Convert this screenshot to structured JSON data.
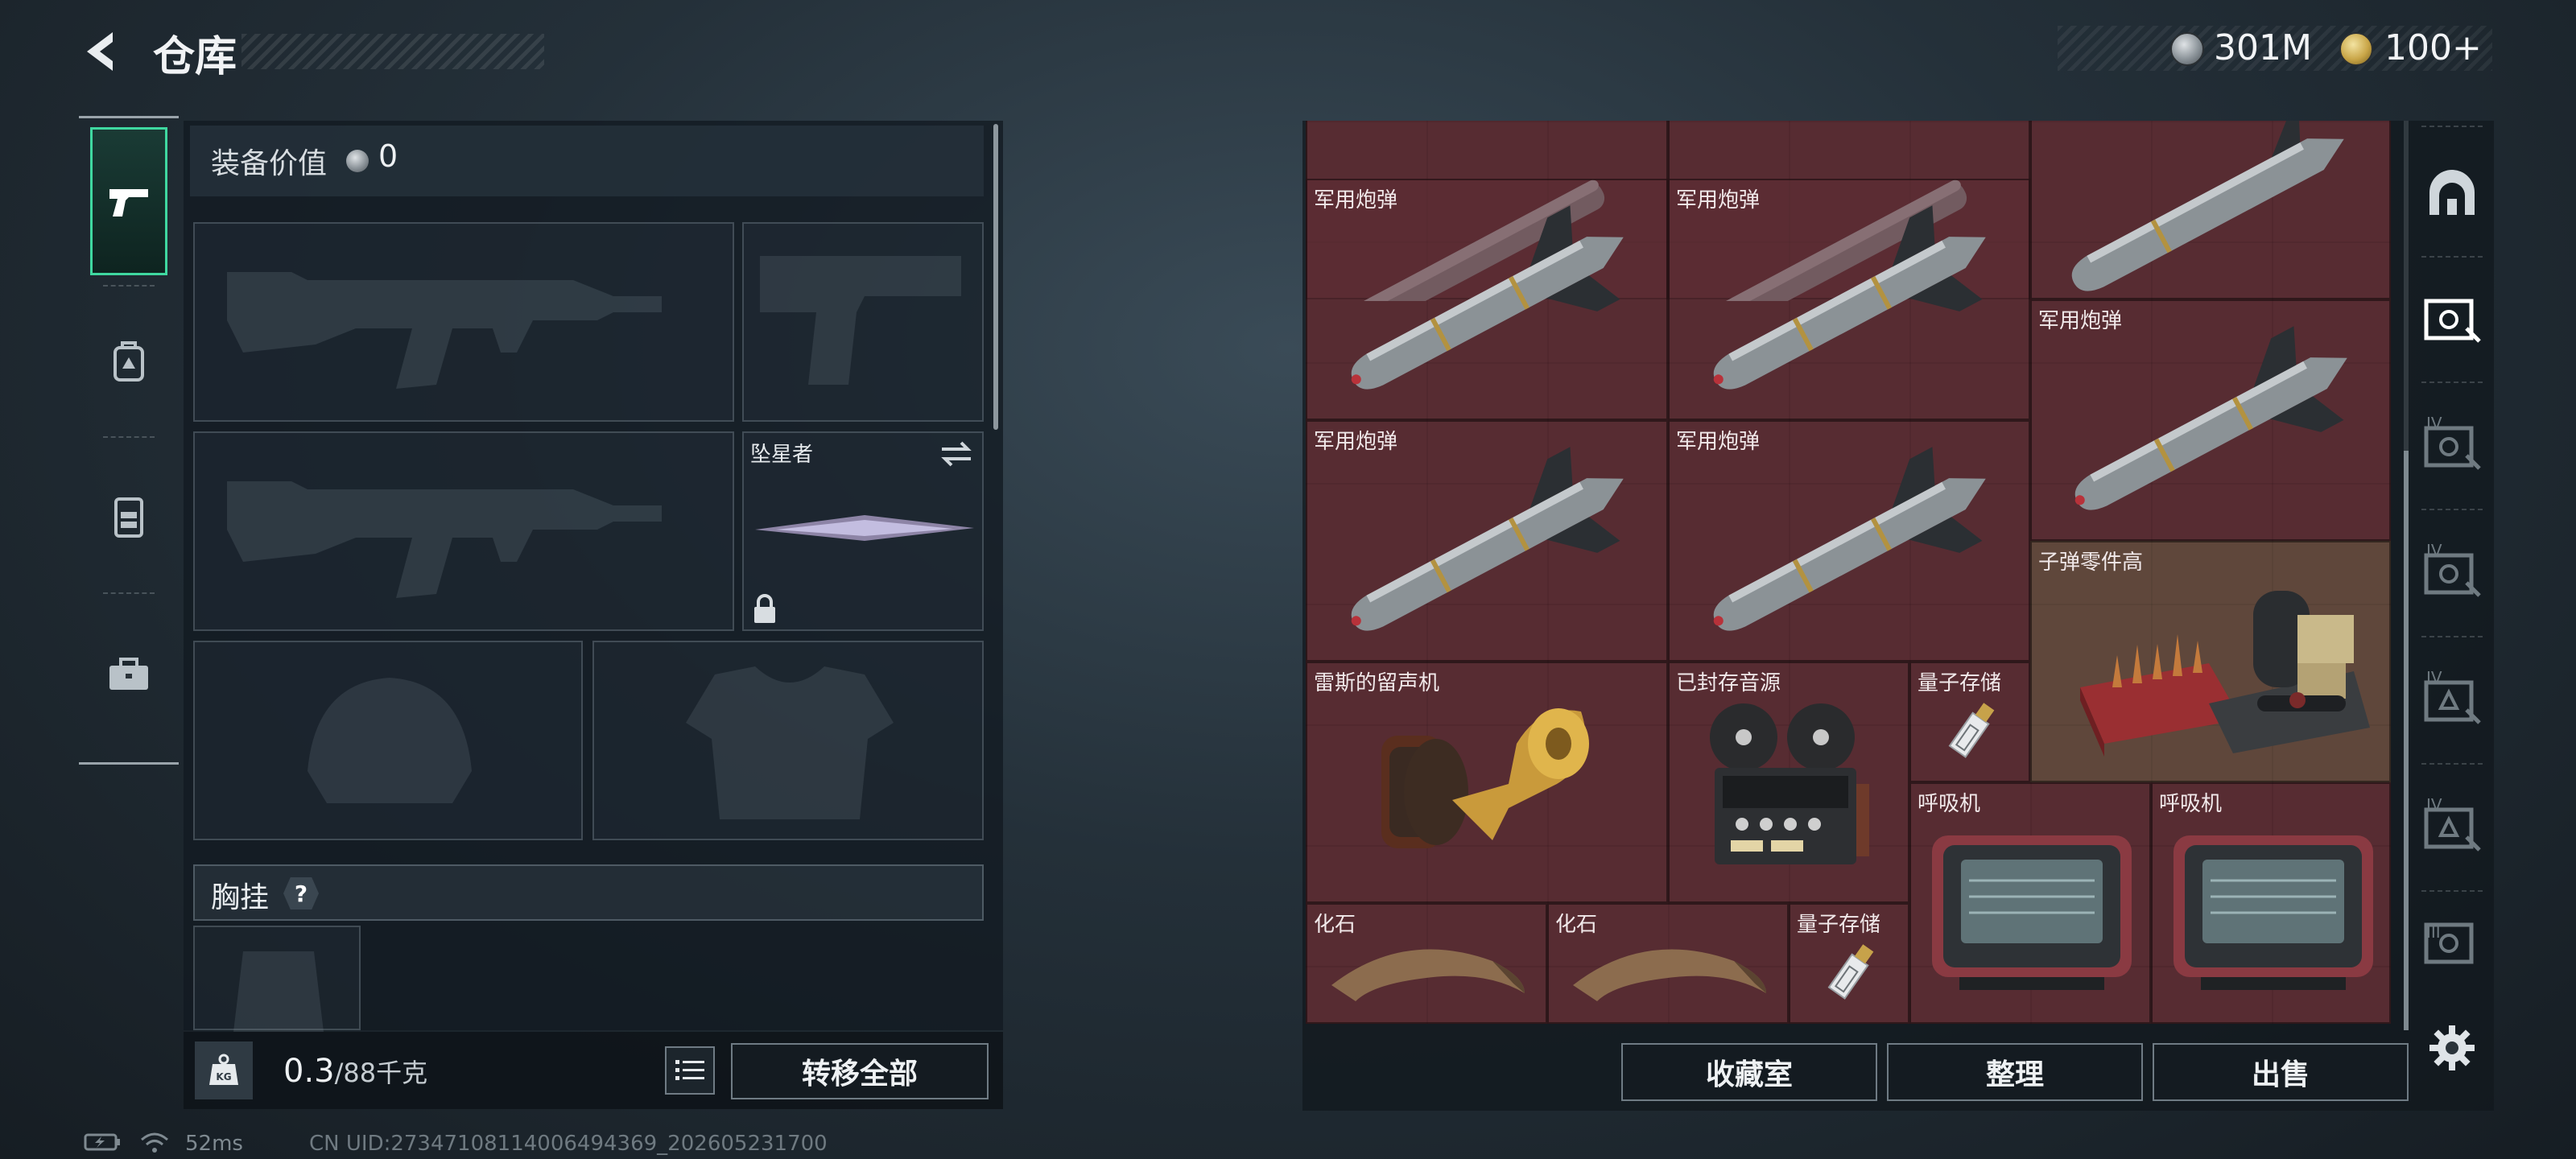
{
  "header": {
    "title": "仓库",
    "currencies": [
      {
        "icon": "silver-coin-icon",
        "value": "301M"
      },
      {
        "icon": "gold-coin-icon",
        "value": "100+"
      }
    ]
  },
  "left_nav": {
    "tabs": [
      {
        "name": "weapons",
        "icon": "pistol-icon",
        "active": true
      },
      {
        "name": "backpack",
        "icon": "backpack-icon",
        "active": false
      },
      {
        "name": "chest-rig",
        "icon": "vest-icon",
        "active": false
      },
      {
        "name": "toolbox",
        "icon": "briefcase-icon",
        "active": false
      }
    ]
  },
  "loadout": {
    "value_label": "装备价值",
    "value": "0",
    "melee_slot_label": "坠星者",
    "chest_rig_label": "胸挂",
    "chest_rig_help": "?",
    "weight_current": "0.3",
    "weight_max": "/88千克",
    "transfer_all": "转移全部"
  },
  "stash": {
    "items": [
      {
        "name": "",
        "kind": "missile"
      },
      {
        "name": "",
        "kind": "missile"
      },
      {
        "name": "",
        "kind": "missile"
      },
      {
        "name": "军用炮弹",
        "kind": "missile"
      },
      {
        "name": "军用炮弹",
        "kind": "missile"
      },
      {
        "name": "军用炮弹",
        "kind": "missile"
      },
      {
        "name": "军用炮弹",
        "kind": "missile"
      },
      {
        "name": "军用炮弹",
        "kind": "missile"
      },
      {
        "name": "子弹零件高",
        "kind": "ammo-parts"
      },
      {
        "name": "雷斯的留声机",
        "kind": "gramophone"
      },
      {
        "name": "已封存音源",
        "kind": "tape-recorder"
      },
      {
        "name": "量子存储",
        "kind": "usb-drive"
      },
      {
        "name": "呼吸机",
        "kind": "ventilator"
      },
      {
        "name": "呼吸机",
        "kind": "ventilator"
      },
      {
        "name": "化石",
        "kind": "fossil"
      },
      {
        "name": "化石",
        "kind": "fossil"
      },
      {
        "name": "量子存储",
        "kind": "usb-drive"
      }
    ],
    "actions": {
      "collection": "收藏室",
      "sort": "整理",
      "sell": "出售"
    }
  },
  "right_tabs": [
    {
      "icon": "arch-icon",
      "badge": ""
    },
    {
      "icon": "safe-icon",
      "badge": ""
    },
    {
      "icon": "safe-icon",
      "badge": "IV"
    },
    {
      "icon": "safe-icon",
      "badge": "IV"
    },
    {
      "icon": "triangle-case-icon",
      "badge": "IV"
    },
    {
      "icon": "triangle-case-icon",
      "badge": "IV"
    },
    {
      "icon": "safe-icon",
      "badge": "III"
    }
  ],
  "status": {
    "ping": "52ms",
    "uid": "CN UID:27347108114006494369_202605231700"
  },
  "colors": {
    "accent": "#3fd8a0",
    "stash_cell": "#4e2a2f"
  }
}
